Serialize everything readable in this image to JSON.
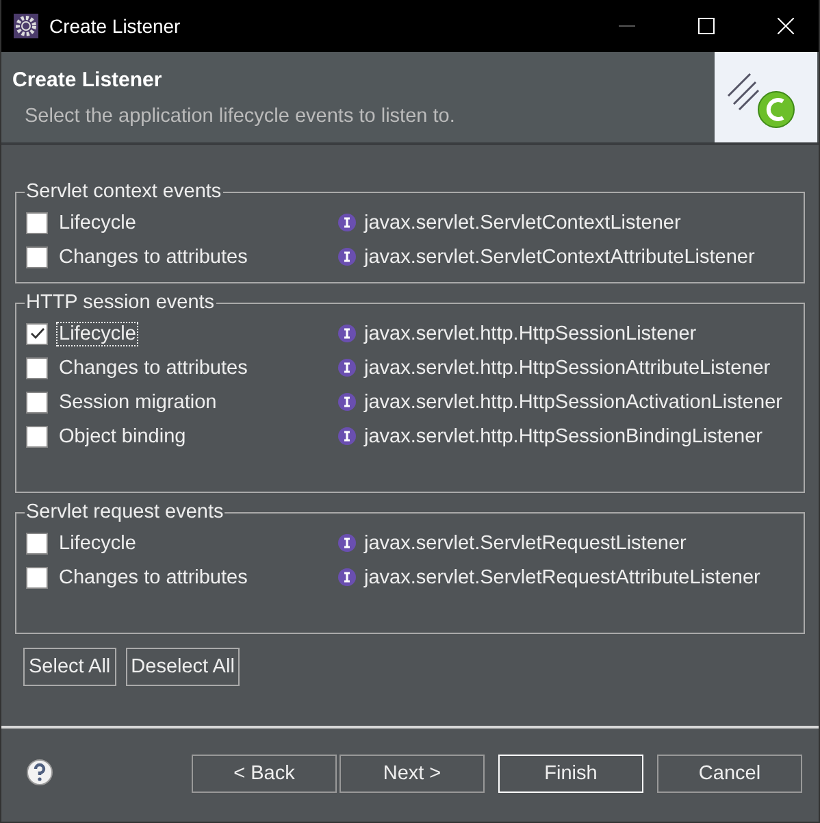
{
  "window": {
    "title": "Create Listener"
  },
  "header": {
    "title": "Create Listener",
    "description": "Select the application lifecycle events to listen to."
  },
  "groups": [
    {
      "title": "Servlet context events",
      "items": [
        {
          "label": "Lifecycle",
          "interface": "javax.servlet.ServletContextListener",
          "checked": false,
          "focused": false
        },
        {
          "label": "Changes to attributes",
          "interface": "javax.servlet.ServletContextAttributeListener",
          "checked": false,
          "focused": false
        }
      ]
    },
    {
      "title": "HTTP session events",
      "items": [
        {
          "label": "Lifecycle",
          "interface": "javax.servlet.http.HttpSessionListener",
          "checked": true,
          "focused": true
        },
        {
          "label": "Changes to attributes",
          "interface": "javax.servlet.http.HttpSessionAttributeListener",
          "checked": false,
          "focused": false
        },
        {
          "label": "Session migration",
          "interface": "javax.servlet.http.HttpSessionActivationListener",
          "checked": false,
          "focused": false
        },
        {
          "label": "Object binding",
          "interface": "javax.servlet.http.HttpSessionBindingListener",
          "checked": false,
          "focused": false
        }
      ]
    },
    {
      "title": "Servlet request events",
      "items": [
        {
          "label": "Lifecycle",
          "interface": "javax.servlet.ServletRequestListener",
          "checked": false,
          "focused": false
        },
        {
          "label": "Changes to attributes",
          "interface": "javax.servlet.ServletRequestAttributeListener",
          "checked": false,
          "focused": false
        }
      ]
    }
  ],
  "selection_buttons": [
    "Select All",
    "Deselect All"
  ],
  "footer_buttons": [
    {
      "label": "< Back",
      "default": false
    },
    {
      "label": "Next >",
      "default": false
    },
    {
      "label": "Finish",
      "default": true
    },
    {
      "label": "Cancel",
      "default": false
    }
  ]
}
